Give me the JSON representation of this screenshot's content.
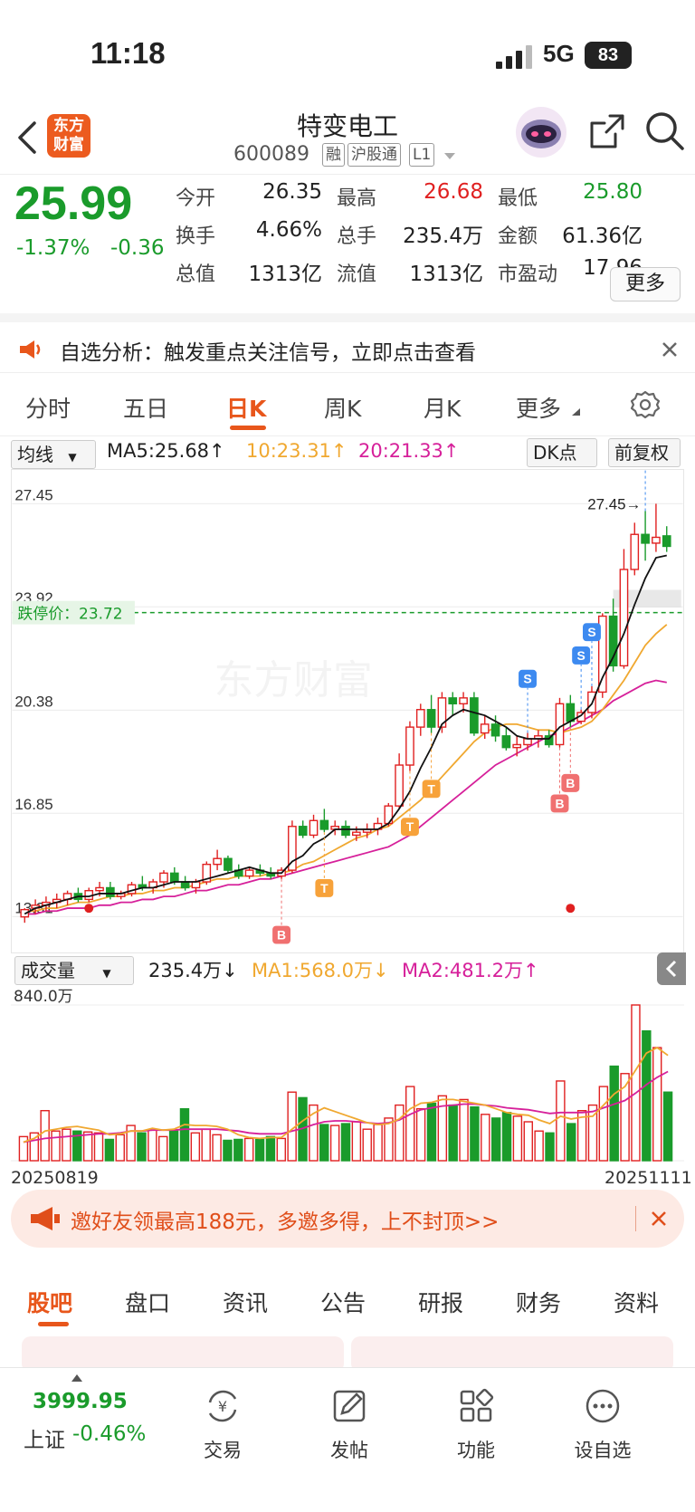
{
  "status_bar": {
    "time": "11:18",
    "network": "5G",
    "battery": "83"
  },
  "header": {
    "logo_text": "东方财富",
    "stock_name": "特变电工",
    "stock_code": "600089",
    "tags": [
      "融",
      "沪股通",
      "L1"
    ]
  },
  "quote": {
    "price": "25.99",
    "change_pct": "-1.37%",
    "change_abs": "-0.36",
    "fields": [
      {
        "label": "今开",
        "value": "26.35",
        "color": "#222"
      },
      {
        "label": "最高",
        "value": "26.68",
        "color": "#e02020"
      },
      {
        "label": "最低",
        "value": "25.80",
        "color": "#1a9b2b"
      },
      {
        "label": "换手",
        "value": "4.66%",
        "color": "#222"
      },
      {
        "label": "总手",
        "value": "235.4万",
        "color": "#222"
      },
      {
        "label": "金额",
        "value": "61.36亿",
        "color": "#222"
      },
      {
        "label": "总值",
        "value": "1313亿",
        "color": "#222"
      },
      {
        "label": "流值",
        "value": "1313亿",
        "color": "#222"
      },
      {
        "label": "市盈动",
        "value": "17.96",
        "color": "#222"
      }
    ],
    "more_label": "更多"
  },
  "notice": {
    "text": "自选分析：触发重点关注信号，立即点击查看"
  },
  "tabs": [
    "分时",
    "五日",
    "日K",
    "周K",
    "月K",
    "更多"
  ],
  "chart_bar": {
    "ma_select": "均线",
    "ma5": "MA5:25.68↑",
    "ma10": "10:23.31↑",
    "ma20": "20:21.33↑",
    "dk": "DK点",
    "fq": "前复权"
  },
  "chart_data": {
    "type": "candlestick",
    "y_ticks": [
      "27.45",
      "23.92",
      "20.38",
      "16.85",
      "13.31"
    ],
    "ylim": [
      12.7,
      28.3
    ],
    "limit_down_label": "跌停价：23.72",
    "limit_down": 23.72,
    "high_marker": "27.45→",
    "x_start": "20250819",
    "x_end": "20251111",
    "candles": [
      [
        13.3,
        13.6,
        13.1,
        13.55
      ],
      [
        13.6,
        13.9,
        13.4,
        13.7
      ],
      [
        13.7,
        14.0,
        13.5,
        13.8
      ],
      [
        13.8,
        14.1,
        13.6,
        13.9
      ],
      [
        13.9,
        14.2,
        13.7,
        14.1
      ],
      [
        14.1,
        14.3,
        13.8,
        13.9
      ],
      [
        13.9,
        14.3,
        13.8,
        14.2
      ],
      [
        14.2,
        14.5,
        14.0,
        14.3
      ],
      [
        14.3,
        14.5,
        13.9,
        14.0
      ],
      [
        14.0,
        14.2,
        13.9,
        14.1
      ],
      [
        14.1,
        14.5,
        14.0,
        14.4
      ],
      [
        14.4,
        14.7,
        14.2,
        14.3
      ],
      [
        14.3,
        14.6,
        14.1,
        14.5
      ],
      [
        14.5,
        14.9,
        14.3,
        14.8
      ],
      [
        14.8,
        15.0,
        14.4,
        14.5
      ],
      [
        14.5,
        14.7,
        14.2,
        14.3
      ],
      [
        14.3,
        14.6,
        14.1,
        14.5
      ],
      [
        14.5,
        15.2,
        14.4,
        15.1
      ],
      [
        15.1,
        15.6,
        14.9,
        15.3
      ],
      [
        15.3,
        15.4,
        14.8,
        14.9
      ],
      [
        14.9,
        15.1,
        14.6,
        14.7
      ],
      [
        14.7,
        15.0,
        14.6,
        14.9
      ],
      [
        14.9,
        15.1,
        14.7,
        14.8
      ],
      [
        14.8,
        15.0,
        14.6,
        14.7
      ],
      [
        14.7,
        15.0,
        14.6,
        14.9
      ],
      [
        14.9,
        16.6,
        14.8,
        16.4
      ],
      [
        16.4,
        16.6,
        16.0,
        16.1
      ],
      [
        16.1,
        16.8,
        16.0,
        16.6
      ],
      [
        16.6,
        17.0,
        16.2,
        16.3
      ],
      [
        16.3,
        16.6,
        16.1,
        16.4
      ],
      [
        16.4,
        16.6,
        16.0,
        16.1
      ],
      [
        16.1,
        16.4,
        15.9,
        16.2
      ],
      [
        16.2,
        16.5,
        16.0,
        16.3
      ],
      [
        16.3,
        16.7,
        16.1,
        16.5
      ],
      [
        16.5,
        17.2,
        16.4,
        17.1
      ],
      [
        17.1,
        18.9,
        17.0,
        18.5
      ],
      [
        18.5,
        20.0,
        18.3,
        19.8
      ],
      [
        19.8,
        20.6,
        19.5,
        20.4
      ],
      [
        20.4,
        20.9,
        19.6,
        19.8
      ],
      [
        19.8,
        21.0,
        19.6,
        20.8
      ],
      [
        20.8,
        21.0,
        20.2,
        20.6
      ],
      [
        20.6,
        21.0,
        20.3,
        20.8
      ],
      [
        20.8,
        21.0,
        19.5,
        19.6
      ],
      [
        19.6,
        20.2,
        19.4,
        19.9
      ],
      [
        19.9,
        20.2,
        19.3,
        19.5
      ],
      [
        19.5,
        19.8,
        19.0,
        19.1
      ],
      [
        19.1,
        19.5,
        18.8,
        19.2
      ],
      [
        19.2,
        19.6,
        19.0,
        19.4
      ],
      [
        19.4,
        19.7,
        19.1,
        19.5
      ],
      [
        19.5,
        19.7,
        19.1,
        19.2
      ],
      [
        19.2,
        20.8,
        19.1,
        20.6
      ],
      [
        20.6,
        20.9,
        19.8,
        20.0
      ],
      [
        20.0,
        20.4,
        19.9,
        20.3
      ],
      [
        20.3,
        21.2,
        20.1,
        21.0
      ],
      [
        21.0,
        23.7,
        20.8,
        23.6
      ],
      [
        23.6,
        24.2,
        21.7,
        21.9
      ],
      [
        21.9,
        25.9,
        21.8,
        25.2
      ],
      [
        25.2,
        26.8,
        25.0,
        26.4
      ],
      [
        26.4,
        27.2,
        25.5,
        26.1
      ],
      [
        26.1,
        27.45,
        25.8,
        26.3
      ],
      [
        26.35,
        26.68,
        25.8,
        25.99
      ]
    ],
    "ma5": [
      13.4,
      13.6,
      13.7,
      13.8,
      13.9,
      14.0,
      14.0,
      14.1,
      14.1,
      14.1,
      14.2,
      14.3,
      14.3,
      14.4,
      14.5,
      14.5,
      14.5,
      14.6,
      14.7,
      14.8,
      14.9,
      15.0,
      14.9,
      14.8,
      14.8,
      15.2,
      15.4,
      15.8,
      16.0,
      16.3,
      16.3,
      16.3,
      16.3,
      16.3,
      16.5,
      17.0,
      17.6,
      18.4,
      19.1,
      19.9,
      20.2,
      20.4,
      20.3,
      20.2,
      20.0,
      19.8,
      19.5,
      19.4,
      19.4,
      19.4,
      19.8,
      20.0,
      20.2,
      20.6,
      21.5,
      22.2,
      23.0,
      24.0,
      24.9,
      25.6,
      25.68
    ],
    "ma10": [
      13.5,
      13.5,
      13.6,
      13.6,
      13.7,
      13.8,
      13.8,
      13.9,
      14.0,
      14.0,
      14.1,
      14.1,
      14.2,
      14.2,
      14.3,
      14.3,
      14.4,
      14.5,
      14.6,
      14.6,
      14.7,
      14.7,
      14.7,
      14.8,
      14.8,
      14.9,
      15.1,
      15.2,
      15.4,
      15.6,
      15.8,
      16.0,
      16.1,
      16.3,
      16.4,
      16.7,
      17.0,
      17.3,
      17.7,
      18.1,
      18.5,
      18.9,
      19.3,
      19.6,
      19.8,
      19.9,
      19.9,
      19.8,
      19.7,
      19.7,
      19.6,
      19.7,
      19.8,
      20.0,
      20.4,
      20.9,
      21.4,
      22.0,
      22.6,
      23.0,
      23.31
    ],
    "ma20": [
      13.4,
      13.4,
      13.5,
      13.5,
      13.6,
      13.6,
      13.6,
      13.7,
      13.7,
      13.8,
      13.8,
      13.9,
      13.9,
      14.0,
      14.0,
      14.1,
      14.2,
      14.2,
      14.3,
      14.4,
      14.4,
      14.5,
      14.6,
      14.6,
      14.7,
      14.8,
      14.9,
      15.0,
      15.1,
      15.2,
      15.3,
      15.4,
      15.5,
      15.6,
      15.7,
      15.9,
      16.1,
      16.4,
      16.7,
      17.0,
      17.3,
      17.6,
      17.9,
      18.2,
      18.5,
      18.7,
      18.9,
      19.1,
      19.3,
      19.5,
      19.6,
      19.8,
      20.0,
      20.2,
      20.4,
      20.7,
      20.9,
      21.1,
      21.3,
      21.4,
      21.33
    ],
    "signals": [
      {
        "i": 24,
        "type": "B"
      },
      {
        "i": 28,
        "type": "T"
      },
      {
        "i": 36,
        "type": "T"
      },
      {
        "i": 38,
        "type": "T"
      },
      {
        "i": 47,
        "type": "S"
      },
      {
        "i": 50,
        "type": "B"
      },
      {
        "i": 51,
        "type": "B"
      },
      {
        "i": 52,
        "type": "S"
      },
      {
        "i": 53,
        "type": "S"
      },
      {
        "i": 58,
        "type": "S"
      }
    ],
    "volume": {
      "label": "成交量",
      "value_label": "235.4万↓",
      "ma1_label": "MA1:568.0万↓",
      "ma2_label": "MA2:481.2万↑",
      "max_label": "840.0万",
      "ymax": 840,
      "values": [
        130,
        150,
        270,
        160,
        170,
        160,
        155,
        150,
        115,
        140,
        190,
        150,
        165,
        130,
        160,
        280,
        150,
        170,
        140,
        110,
        115,
        120,
        115,
        130,
        120,
        370,
        340,
        300,
        195,
        190,
        200,
        210,
        170,
        195,
        230,
        300,
        400,
        280,
        310,
        350,
        300,
        330,
        290,
        250,
        230,
        260,
        240,
        210,
        160,
        150,
        430,
        200,
        270,
        300,
        400,
        510,
        470,
        840,
        700,
        610,
        370
      ],
      "ma1": [
        100,
        120,
        160,
        170,
        180,
        185,
        175,
        165,
        140,
        145,
        160,
        160,
        175,
        165,
        170,
        195,
        190,
        190,
        185,
        170,
        140,
        125,
        120,
        125,
        125,
        170,
        215,
        255,
        285,
        265,
        245,
        225,
        205,
        195,
        200,
        225,
        280,
        310,
        315,
        330,
        330,
        320,
        310,
        300,
        280,
        260,
        250,
        245,
        220,
        200,
        240,
        225,
        235,
        240,
        300,
        360,
        400,
        490,
        580,
        610,
        568
      ],
      "ma2": [
        100,
        110,
        120,
        125,
        130,
        135,
        140,
        145,
        145,
        150,
        160,
        160,
        165,
        165,
        165,
        170,
        170,
        170,
        170,
        165,
        160,
        150,
        145,
        145,
        145,
        160,
        175,
        195,
        210,
        215,
        215,
        210,
        205,
        200,
        205,
        220,
        250,
        275,
        285,
        295,
        300,
        305,
        305,
        300,
        295,
        285,
        280,
        275,
        265,
        255,
        260,
        260,
        260,
        265,
        285,
        305,
        325,
        365,
        410,
        450,
        481.2
      ]
    }
  },
  "banner": {
    "text": "邀好友领最高188元，多邀多得，上不封顶>>"
  },
  "sub_tabs": [
    "股吧",
    "盘口",
    "资讯",
    "公告",
    "研报",
    "财务",
    "资料"
  ],
  "bottom_nav": {
    "index_value": "3999.95",
    "index_name": "上证",
    "index_change": "-0.46%",
    "items": [
      "交易",
      "发帖",
      "功能",
      "设自选"
    ]
  }
}
